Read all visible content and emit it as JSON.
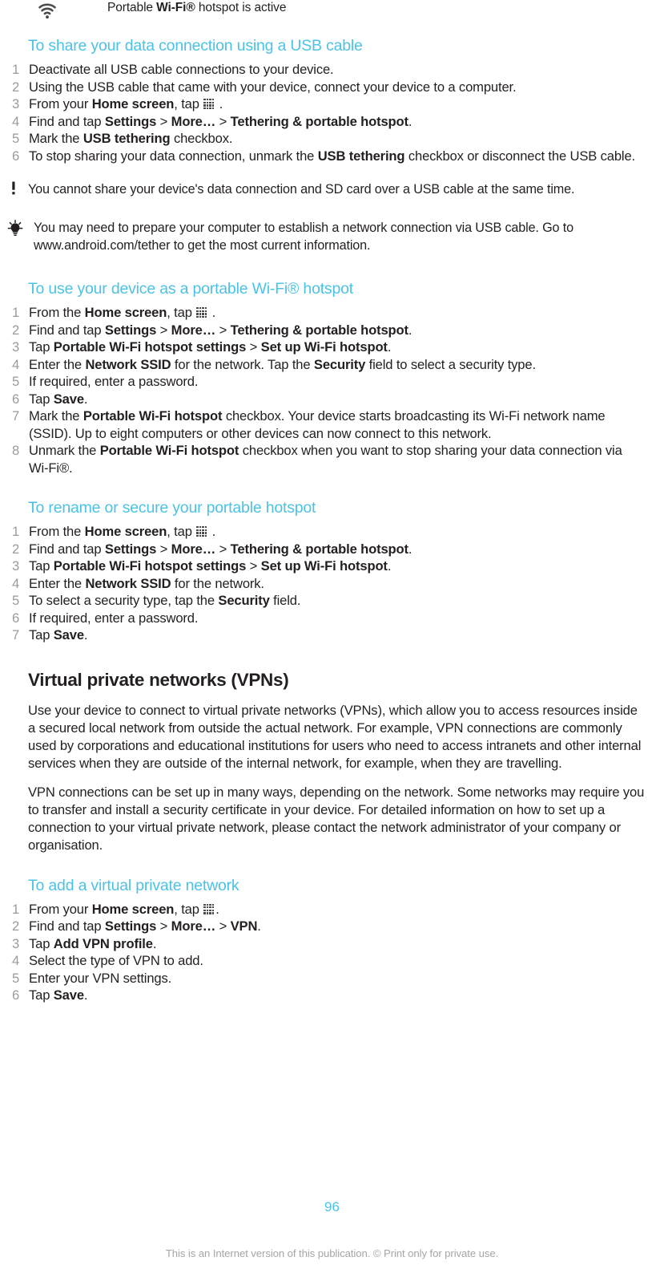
{
  "header": {
    "icon": "wifi-icon",
    "title_pre": "Portable ",
    "title_bold": "Wi-Fi®",
    "title_post": " hotspot is active",
    "title_full": "Portable Wi-Fi® hotspot is active"
  },
  "colors": {
    "heading_accent": "#4cc2e4",
    "body_text": "#231f20",
    "step_number": "#9b9b9b",
    "footer_text": "#a6a6a6"
  },
  "sections": {
    "usb": {
      "heading": "To share your data connection using a USB cable",
      "steps": [
        {
          "parts": [
            {
              "t": "Deactivate all USB cable connections to your device.",
              "b": false
            }
          ]
        },
        {
          "parts": [
            {
              "t": "Using the USB cable that came with your device, connect your device to a computer.",
              "b": false
            }
          ]
        },
        {
          "parts": [
            {
              "t": "From your ",
              "b": false
            },
            {
              "t": "Home screen",
              "b": true
            },
            {
              "t": ", tap ",
              "b": false
            },
            {
              "icon": "app-grid-icon"
            },
            {
              "t": " .",
              "b": false
            }
          ]
        },
        {
          "parts": [
            {
              "t": "Find and tap ",
              "b": false
            },
            {
              "t": "Settings",
              "b": true
            },
            {
              "t": " > ",
              "b": false
            },
            {
              "t": "More…",
              "b": true
            },
            {
              "t": " > ",
              "b": false
            },
            {
              "t": "Tethering & portable hotspot",
              "b": true
            },
            {
              "t": ".",
              "b": false
            }
          ]
        },
        {
          "parts": [
            {
              "t": "Mark the ",
              "b": false
            },
            {
              "t": "USB tethering",
              "b": true
            },
            {
              "t": " checkbox.",
              "b": false
            }
          ]
        },
        {
          "parts": [
            {
              "t": "To stop sharing your data connection, unmark the ",
              "b": false
            },
            {
              "t": "USB tethering",
              "b": true
            },
            {
              "t": " checkbox or disconnect the USB cable.",
              "b": false
            }
          ]
        }
      ],
      "note": {
        "icon": "exclamation-icon",
        "text": "You cannot share your device's data connection and SD card over a USB cable at the same time."
      },
      "tip": {
        "icon": "lightbulb-icon",
        "text": "You may need to prepare your computer to establish a network connection via USB cable. Go to www.android.com/tether to get the most current information."
      }
    },
    "hotspot": {
      "heading": "To use your device as a portable Wi-Fi® hotspot",
      "steps": [
        {
          "parts": [
            {
              "t": "From the ",
              "b": false
            },
            {
              "t": "Home screen",
              "b": true
            },
            {
              "t": ", tap ",
              "b": false
            },
            {
              "icon": "app-grid-icon"
            },
            {
              "t": " .",
              "b": false
            }
          ]
        },
        {
          "parts": [
            {
              "t": "Find and tap ",
              "b": false
            },
            {
              "t": "Settings",
              "b": true
            },
            {
              "t": " > ",
              "b": false
            },
            {
              "t": "More…",
              "b": true
            },
            {
              "t": " > ",
              "b": false
            },
            {
              "t": "Tethering & portable hotspot",
              "b": true
            },
            {
              "t": ".",
              "b": false
            }
          ]
        },
        {
          "parts": [
            {
              "t": "Tap ",
              "b": false
            },
            {
              "t": "Portable Wi-Fi hotspot settings",
              "b": true
            },
            {
              "t": " > ",
              "b": false
            },
            {
              "t": "Set up Wi-Fi hotspot",
              "b": true
            },
            {
              "t": ".",
              "b": false
            }
          ]
        },
        {
          "parts": [
            {
              "t": "Enter the ",
              "b": false
            },
            {
              "t": "Network SSID",
              "b": true
            },
            {
              "t": " for the network. Tap the ",
              "b": false
            },
            {
              "t": "Security",
              "b": true
            },
            {
              "t": " field to select a security type.",
              "b": false
            }
          ]
        },
        {
          "parts": [
            {
              "t": "If required, enter a password.",
              "b": false
            }
          ]
        },
        {
          "parts": [
            {
              "t": "Tap ",
              "b": false
            },
            {
              "t": "Save",
              "b": true
            },
            {
              "t": ".",
              "b": false
            }
          ]
        },
        {
          "parts": [
            {
              "t": "Mark the ",
              "b": false
            },
            {
              "t": "Portable Wi-Fi hotspot",
              "b": true
            },
            {
              "t": " checkbox. Your device starts broadcasting its Wi-Fi network name (SSID). Up to eight computers or other devices can now connect to this network.",
              "b": false
            }
          ]
        },
        {
          "parts": [
            {
              "t": "Unmark the ",
              "b": false
            },
            {
              "t": "Portable Wi-Fi hotspot",
              "b": true
            },
            {
              "t": " checkbox when you want to stop sharing your data connection via Wi-Fi®.",
              "b": false
            }
          ]
        }
      ]
    },
    "rename": {
      "heading": "To rename or secure your portable hotspot",
      "steps": [
        {
          "parts": [
            {
              "t": "From the ",
              "b": false
            },
            {
              "t": "Home screen",
              "b": true
            },
            {
              "t": ", tap ",
              "b": false
            },
            {
              "icon": "app-grid-icon"
            },
            {
              "t": " .",
              "b": false
            }
          ]
        },
        {
          "parts": [
            {
              "t": "Find and tap ",
              "b": false
            },
            {
              "t": "Settings",
              "b": true
            },
            {
              "t": " > ",
              "b": false
            },
            {
              "t": "More…",
              "b": true
            },
            {
              "t": " > ",
              "b": false
            },
            {
              "t": "Tethering & portable hotspot",
              "b": true
            },
            {
              "t": ".",
              "b": false
            }
          ]
        },
        {
          "parts": [
            {
              "t": "Tap ",
              "b": false
            },
            {
              "t": "Portable Wi-Fi hotspot settings",
              "b": true
            },
            {
              "t": " > ",
              "b": false
            },
            {
              "t": "Set up Wi-Fi hotspot",
              "b": true
            },
            {
              "t": ".",
              "b": false
            }
          ]
        },
        {
          "parts": [
            {
              "t": "Enter the ",
              "b": false
            },
            {
              "t": "Network SSID",
              "b": true
            },
            {
              "t": " for the network.",
              "b": false
            }
          ]
        },
        {
          "parts": [
            {
              "t": "To select a security type, tap the ",
              "b": false
            },
            {
              "t": "Security",
              "b": true
            },
            {
              "t": " field.",
              "b": false
            }
          ]
        },
        {
          "parts": [
            {
              "t": "If required, enter a password.",
              "b": false
            }
          ]
        },
        {
          "parts": [
            {
              "t": "Tap ",
              "b": false
            },
            {
              "t": "Save",
              "b": true
            },
            {
              "t": ".",
              "b": false
            }
          ]
        }
      ]
    },
    "vpn": {
      "chapter_heading": "Virtual private networks (VPNs)",
      "paragraphs": [
        "Use your device to connect to virtual private networks (VPNs), which allow you to access resources inside a secured local network from outside the actual network. For example, VPN connections are commonly used by corporations and educational institutions for users who need to access intranets and other internal services when they are outside of the internal network, for example, when they are travelling.",
        "VPN connections can be set up in many ways, depending on the network. Some networks may require you to transfer and install a security certificate in your device. For detailed information on how to set up a connection to your virtual private network, please contact the network administrator of your company or organisation."
      ],
      "add_heading": "To add a virtual private network",
      "steps": [
        {
          "parts": [
            {
              "t": "From your ",
              "b": false
            },
            {
              "t": "Home screen",
              "b": true
            },
            {
              "t": ", tap ",
              "b": false
            },
            {
              "icon": "app-grid-icon"
            },
            {
              "t": ".",
              "b": false
            }
          ]
        },
        {
          "parts": [
            {
              "t": "Find and tap ",
              "b": false
            },
            {
              "t": "Settings",
              "b": true
            },
            {
              "t": " > ",
              "b": false
            },
            {
              "t": "More…",
              "b": true
            },
            {
              "t": " > ",
              "b": false
            },
            {
              "t": "VPN",
              "b": true
            },
            {
              "t": ".",
              "b": false
            }
          ]
        },
        {
          "parts": [
            {
              "t": "Tap ",
              "b": false
            },
            {
              "t": "Add VPN profile",
              "b": true
            },
            {
              "t": ".",
              "b": false
            }
          ]
        },
        {
          "parts": [
            {
              "t": "Select the type of VPN to add.",
              "b": false
            }
          ]
        },
        {
          "parts": [
            {
              "t": "Enter your VPN settings.",
              "b": false
            }
          ]
        },
        {
          "parts": [
            {
              "t": "Tap ",
              "b": false
            },
            {
              "t": "Save",
              "b": true
            },
            {
              "t": ".",
              "b": false
            }
          ]
        }
      ]
    }
  },
  "footer": {
    "page_number": "96",
    "legal": "This is an Internet version of this publication. © Print only for private use."
  }
}
